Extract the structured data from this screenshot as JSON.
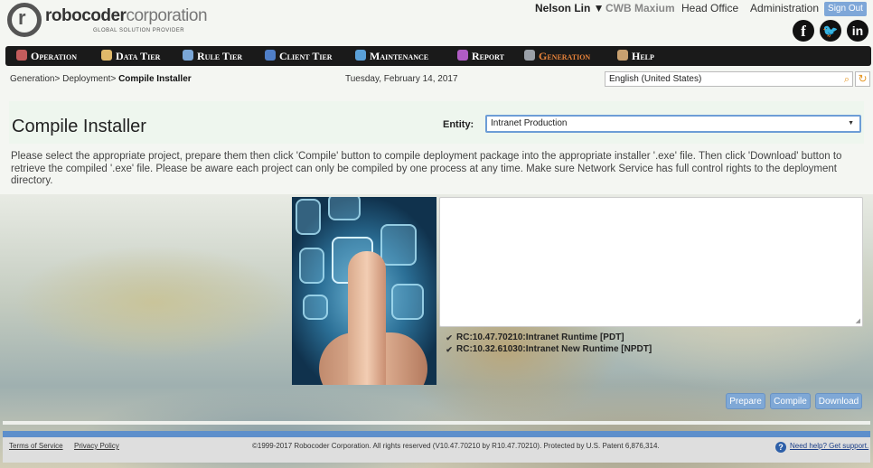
{
  "brand": {
    "name_bold": "robocoder",
    "name_light": "corporation",
    "tagline": "GLOBAL SOLUTION PROVIDER"
  },
  "topnav": {
    "user": "Nelson Lin ▼",
    "cwb": "CWB Maxium",
    "office": "Head Office",
    "admin": "Administration",
    "signout": "Sign Out"
  },
  "social": [
    "facebook-icon",
    "twitter-icon",
    "linkedin-icon"
  ],
  "menu": [
    {
      "label": "Operation",
      "icon": "operation-icon",
      "color": "#c45c5c"
    },
    {
      "label": "Data Tier",
      "icon": "data-tier-icon",
      "color": "#e0b96a"
    },
    {
      "label": "Rule Tier",
      "icon": "rule-tier-icon",
      "color": "#7aa6d6"
    },
    {
      "label": "Client Tier",
      "icon": "client-tier-icon",
      "color": "#4f7fc8"
    },
    {
      "label": "Maintenance",
      "icon": "maintenance-icon",
      "color": "#5aa0d8"
    },
    {
      "label": "Report",
      "icon": "report-icon",
      "color": "#b05cc4"
    },
    {
      "label": "Generation",
      "icon": "generation-icon",
      "color": "#9aa0a8",
      "active": true
    },
    {
      "label": "Help",
      "icon": "help-icon",
      "color": "#c8a070"
    }
  ],
  "breadcrumb": {
    "parts": "Generation> Deployment> ",
    "current": "Compile Installer"
  },
  "date": "Tuesday, February 14, 2017",
  "language": {
    "value": "English (United States)"
  },
  "page": {
    "title": "Compile Installer",
    "entity_label": "Entity:",
    "entity_value": "Intranet Production",
    "instructions": "Please select the appropriate project, prepare them then click 'Compile' button to compile deployment package into the appropriate installer '.exe' file. Then click 'Download' button to retrieve the compiled '.exe' file. Please be aware each project can only be compiled by one process at any time. Make sure Network Service has full control rights to the deployment directory.",
    "projects": [
      {
        "label": "RC:10.47.70210:Intranet Runtime [PDT]",
        "checked": true
      },
      {
        "label": "RC:10.32.61030:Intranet New Runtime [NPDT]",
        "checked": true
      }
    ],
    "buttons": {
      "prepare": "Prepare",
      "compile": "Compile",
      "download": "Download"
    }
  },
  "footer": {
    "terms": "Terms of Service",
    "privacy": "Privacy Policy",
    "copyright": "©1999-2017 Robocoder Corporation. All rights reserved (V10.47.70210 by R10.47.70210). Protected by U.S. Patent 6,876,314.",
    "help": "Need help? Get support."
  },
  "colors": {
    "accent": "#7fa8d6",
    "menu_bg": "#1a1a1a",
    "menu_active": "#e8833a",
    "footer_strip": "#5d8fcb"
  }
}
